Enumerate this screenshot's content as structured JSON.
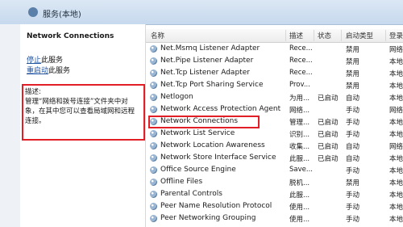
{
  "window": {
    "title": "服务(本地)"
  },
  "left_pane": {
    "service_title": "Network Connections",
    "stop_link": "停止",
    "stop_suffix": "此服务",
    "restart_link": "重启动",
    "restart_suffix": "此服务",
    "description_label": "描述:",
    "description_lines": [
      "管理“网络和拨号连接”文件夹中对",
      "象，在其中您可以查看局域网和远程",
      "连接。"
    ]
  },
  "columns": {
    "name": "名称",
    "description": "描述",
    "status": "状态",
    "startup": "启动类型",
    "logon": "登录"
  },
  "services": [
    {
      "name": "Net.Msmq Listener Adapter",
      "description": "Rece...",
      "status": "",
      "startup": "禁用",
      "logon": "网络"
    },
    {
      "name": "Net.Pipe Listener Adapter",
      "description": "Rece...",
      "status": "",
      "startup": "禁用",
      "logon": "本地"
    },
    {
      "name": "Net.Tcp Listener Adapter",
      "description": "Rece...",
      "status": "",
      "startup": "禁用",
      "logon": "本地"
    },
    {
      "name": "Net.Tcp Port Sharing Service",
      "description": "Prov...",
      "status": "",
      "startup": "禁用",
      "logon": "本地"
    },
    {
      "name": "Netlogon",
      "description": "为用...",
      "status": "已启动",
      "startup": "自动",
      "logon": "本地"
    },
    {
      "name": "Network Access Protection Agent",
      "description": "网络...",
      "status": "",
      "startup": "手动",
      "logon": "网络"
    },
    {
      "name": "Network Connections",
      "description": "管理...",
      "status": "已启动",
      "startup": "手动",
      "logon": "本地"
    },
    {
      "name": "Network List Service",
      "description": "识别...",
      "status": "已启动",
      "startup": "手动",
      "logon": "本地"
    },
    {
      "name": "Network Location Awareness",
      "description": "收集...",
      "status": "已启动",
      "startup": "自动",
      "logon": "网络"
    },
    {
      "name": "Network Store Interface Service",
      "description": "此服...",
      "status": "已启动",
      "startup": "自动",
      "logon": "本地"
    },
    {
      "name": "Office  Source Engine",
      "description": "Save...",
      "status": "",
      "startup": "手动",
      "logon": "本地"
    },
    {
      "name": "Offline Files",
      "description": "脱机...",
      "status": "",
      "startup": "禁用",
      "logon": "本地"
    },
    {
      "name": "Parental Controls",
      "description": "此服...",
      "status": "",
      "startup": "手动",
      "logon": "本地"
    },
    {
      "name": "Peer Name Resolution Protocol",
      "description": "使用...",
      "status": "",
      "startup": "手动",
      "logon": "本地"
    },
    {
      "name": "Peer Networking Grouping",
      "description": "使用...",
      "status": "",
      "startup": "手动",
      "logon": "本地"
    }
  ],
  "colors": {
    "highlight_border": "#e21f26",
    "link": "#1f52a0"
  }
}
